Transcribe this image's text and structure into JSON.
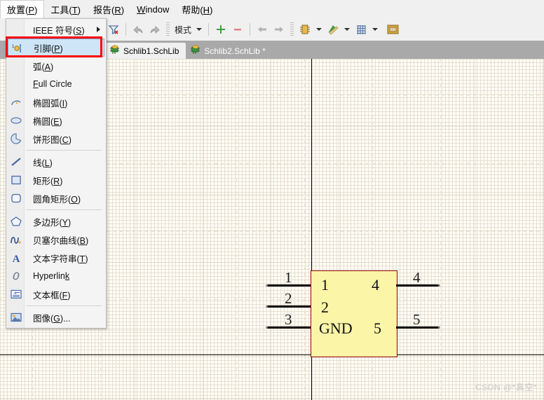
{
  "app": {
    "accent_blue": "#cde5f7",
    "highlight_red": "#ff0000",
    "canvas_bg": "#fffdf5",
    "component_fill": "#fbf5a8",
    "component_border": "#8a0000"
  },
  "menubar": {
    "items": [
      {
        "label": "放置(P)",
        "mnemonic": "P",
        "active": true,
        "name": "menu-place"
      },
      {
        "label": "工具(T)",
        "mnemonic": "T",
        "active": false,
        "name": "menu-tools"
      },
      {
        "label": "报告(R)",
        "mnemonic": "R",
        "active": false,
        "name": "menu-reports"
      },
      {
        "label": "Window",
        "mnemonic": "W",
        "active": false,
        "name": "menu-window"
      },
      {
        "label": "帮助(H)",
        "mnemonic": "H",
        "active": false,
        "name": "menu-help"
      }
    ]
  },
  "toolbar": {
    "mode_label": "模式",
    "items": [
      {
        "name": "clear-filter-icon",
        "glyph": "filter"
      },
      {
        "name": "undo-icon",
        "glyph": "undo"
      },
      {
        "name": "redo-icon",
        "glyph": "redo"
      },
      {
        "name": "mode-dropdown",
        "glyph": "text"
      },
      {
        "name": "add-part-icon",
        "glyph": "plus"
      },
      {
        "name": "remove-part-icon",
        "glyph": "minus"
      },
      {
        "name": "previous-part-icon",
        "glyph": "arrow-left"
      },
      {
        "name": "next-part-icon",
        "glyph": "arrow-right"
      },
      {
        "name": "place-component-icon",
        "glyph": "chip"
      },
      {
        "name": "drawing-tools-icon",
        "glyph": "pencil-ruler"
      },
      {
        "name": "grid-icon",
        "glyph": "grid"
      },
      {
        "name": "library-icon",
        "glyph": "folder"
      }
    ]
  },
  "tabs": [
    {
      "label": "Schlib1.SchLib",
      "active": true,
      "modified": false,
      "name": "tab-schlib1"
    },
    {
      "label": "Schlib2.SchLib *",
      "active": false,
      "modified": true,
      "name": "tab-schlib2"
    }
  ],
  "place_menu": {
    "items": [
      {
        "label": "IEEE 符号(S)",
        "icon": "none",
        "submenu": true,
        "selected": false,
        "separator_after": false,
        "name": "menu-item-ieee-symbols"
      },
      {
        "label": "引脚(P)",
        "icon": "pin",
        "submenu": false,
        "selected": true,
        "separator_after": false,
        "name": "menu-item-pin"
      },
      {
        "label": "弧(A)",
        "icon": "none",
        "submenu": false,
        "selected": false,
        "separator_after": false,
        "name": "menu-item-arc"
      },
      {
        "label": "Full Circle",
        "icon": "none",
        "submenu": false,
        "selected": false,
        "separator_after": false,
        "name": "menu-item-full-circle"
      },
      {
        "label": "椭圆弧(I)",
        "icon": "elliptic-arc",
        "submenu": false,
        "selected": false,
        "separator_after": false,
        "name": "menu-item-elliptical-arc"
      },
      {
        "label": "椭圆(E)",
        "icon": "ellipse",
        "submenu": false,
        "selected": false,
        "separator_after": false,
        "name": "menu-item-ellipse"
      },
      {
        "label": "饼形图(C)",
        "icon": "pie",
        "submenu": false,
        "selected": false,
        "separator_after": true,
        "name": "menu-item-pie-chart"
      },
      {
        "label": "线(L)",
        "icon": "line",
        "submenu": false,
        "selected": false,
        "separator_after": false,
        "name": "menu-item-line"
      },
      {
        "label": "矩形(R)",
        "icon": "rectangle",
        "submenu": false,
        "selected": false,
        "separator_after": false,
        "name": "menu-item-rectangle"
      },
      {
        "label": "圆角矩形(O)",
        "icon": "round-rect",
        "submenu": false,
        "selected": false,
        "separator_after": true,
        "name": "menu-item-round-rectangle"
      },
      {
        "label": "多边形(Y)",
        "icon": "polygon",
        "submenu": false,
        "selected": false,
        "separator_after": false,
        "name": "menu-item-polygon"
      },
      {
        "label": "贝塞尔曲线(B)",
        "icon": "bezier",
        "submenu": false,
        "selected": false,
        "separator_after": false,
        "name": "menu-item-bezier"
      },
      {
        "label": "文本字符串(T)",
        "icon": "text-a",
        "submenu": false,
        "selected": false,
        "separator_after": false,
        "name": "menu-item-text-string"
      },
      {
        "label": "Hyperlink",
        "icon": "hyperlink",
        "submenu": false,
        "selected": false,
        "separator_after": false,
        "name": "menu-item-hyperlink"
      },
      {
        "label": "文本框(F)",
        "icon": "text-frame",
        "submenu": false,
        "selected": false,
        "separator_after": true,
        "name": "menu-item-text-frame"
      },
      {
        "label": "图像(G)...",
        "icon": "image",
        "submenu": false,
        "selected": false,
        "separator_after": false,
        "name": "menu-item-graphic"
      }
    ]
  },
  "schematic": {
    "component": {
      "left_pins": [
        {
          "number": "1",
          "name": "1",
          "name_visible": true
        },
        {
          "number": "2",
          "name": "2",
          "name_visible": true
        },
        {
          "number": "3",
          "name": "GND",
          "name_visible": true
        }
      ],
      "right_pins": [
        {
          "number": "4",
          "name": "4",
          "name_visible": true
        },
        {
          "number": "5",
          "name": "5",
          "name_visible": true
        }
      ]
    },
    "watermark": "CSDN @*真空*"
  }
}
